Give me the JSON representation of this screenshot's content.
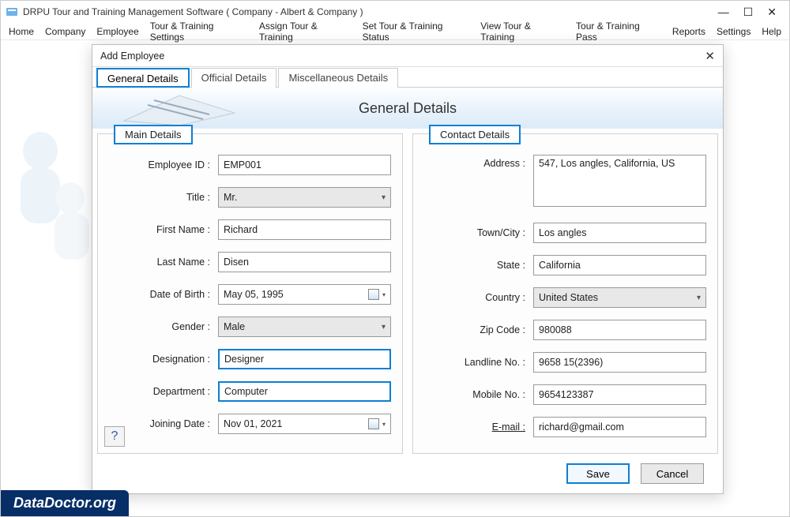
{
  "window": {
    "title": "DRPU Tour and Training Management Software  ( Company - Albert & Company )"
  },
  "menubar": [
    "Home",
    "Company",
    "Employee",
    "Tour & Training Settings",
    "Assign Tour & Training",
    "Set Tour & Training Status",
    "View Tour & Training",
    "Tour & Training Pass",
    "Reports",
    "Settings",
    "Help"
  ],
  "dialog": {
    "title": "Add Employee",
    "tabs": [
      "General Details",
      "Official Details",
      "Miscellaneous Details"
    ],
    "heading": "General Details",
    "group_main": "Main Details",
    "group_contact": "Contact Details",
    "buttons": {
      "save": "Save",
      "cancel": "Cancel"
    }
  },
  "labels": {
    "employee_id": "Employee ID :",
    "title": "Title :",
    "first_name": "First Name :",
    "last_name": "Last Name :",
    "dob": "Date of Birth :",
    "gender": "Gender :",
    "designation": "Designation :",
    "department": "Department :",
    "joining": "Joining Date :",
    "address": "Address :",
    "town": "Town/City :",
    "state": "State :",
    "country": "Country :",
    "zip": "Zip Code :",
    "landline": "Landline No. :",
    "mobile": "Mobile No. :",
    "email": "E-mail :"
  },
  "values": {
    "employee_id": "EMP001",
    "title": "Mr.",
    "first_name": "Richard",
    "last_name": "Disen",
    "dob": "May 05, 1995",
    "gender": "Male",
    "designation": "Designer",
    "department": "Computer",
    "joining": "Nov 01, 2021",
    "address": "547, Los angles, California, US",
    "town": "Los angles",
    "state": "California",
    "country": "United States",
    "zip": "980088",
    "landline": "9658 15(2396)",
    "mobile": "9654123387",
    "email": "richard@gmail.com"
  },
  "footer": {
    "logo": "DataDoctor.org"
  }
}
